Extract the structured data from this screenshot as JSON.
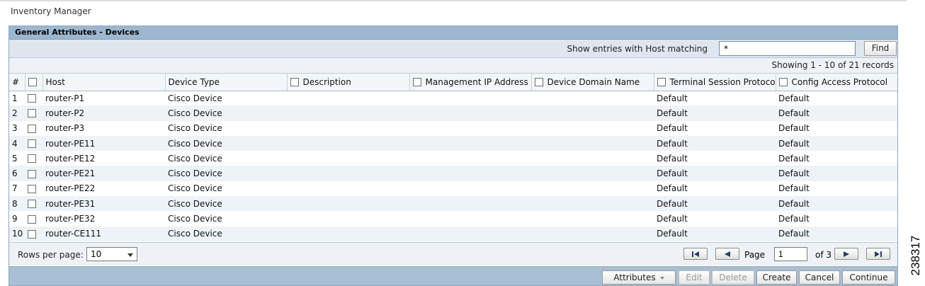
{
  "app": {
    "title": "Inventory Manager"
  },
  "figure_id": "238317",
  "panel": {
    "title": "General Attributes - Devices"
  },
  "filter": {
    "label": "Show entries with Host matching",
    "value": "*",
    "find_label": "Find"
  },
  "records_summary": "Showing 1 - 10 of 21 records",
  "columns": {
    "index": "#",
    "host": "Host",
    "device_type": "Device Type",
    "description": "Description",
    "mgmt_ip": "Management IP Address",
    "domain": "Device Domain Name",
    "terminal": "Terminal Session Protocol",
    "config": "Config Access Protocol"
  },
  "rows": [
    {
      "index": "1",
      "host": "router-P1",
      "device_type": "Cisco Device",
      "terminal": "Default",
      "config": "Default"
    },
    {
      "index": "2",
      "host": "router-P2",
      "device_type": "Cisco Device",
      "terminal": "Default",
      "config": "Default"
    },
    {
      "index": "3",
      "host": "router-P3",
      "device_type": "Cisco Device",
      "terminal": "Default",
      "config": "Default"
    },
    {
      "index": "4",
      "host": "router-PE11",
      "device_type": "Cisco Device",
      "terminal": "Default",
      "config": "Default"
    },
    {
      "index": "5",
      "host": "router-PE12",
      "device_type": "Cisco Device",
      "terminal": "Default",
      "config": "Default"
    },
    {
      "index": "6",
      "host": "router-PE21",
      "device_type": "Cisco Device",
      "terminal": "Default",
      "config": "Default"
    },
    {
      "index": "7",
      "host": "router-PE22",
      "device_type": "Cisco Device",
      "terminal": "Default",
      "config": "Default"
    },
    {
      "index": "8",
      "host": "router-PE31",
      "device_type": "Cisco Device",
      "terminal": "Default",
      "config": "Default"
    },
    {
      "index": "9",
      "host": "router-PE32",
      "device_type": "Cisco Device",
      "terminal": "Default",
      "config": "Default"
    },
    {
      "index": "10",
      "host": "router-CE111",
      "device_type": "Cisco Device",
      "terminal": "Default",
      "config": "Default"
    }
  ],
  "pager": {
    "rows_per_page_label": "Rows per page:",
    "rows_per_page_value": "10",
    "page_label": "Page",
    "page_value": "1",
    "of_label": "of 3",
    "icons": [
      "first-page-icon",
      "prev-page-icon",
      "next-page-icon",
      "last-page-icon"
    ]
  },
  "actions": {
    "attributes": "Attributes",
    "edit": "Edit",
    "delete": "Delete",
    "create": "Create",
    "cancel": "Cancel",
    "continue": "Continue"
  },
  "colors": {
    "header": "#9db7cf",
    "action_bar": "#a9bfd3",
    "link": "#1c6ea6",
    "row_alt": "#eef3f8"
  }
}
